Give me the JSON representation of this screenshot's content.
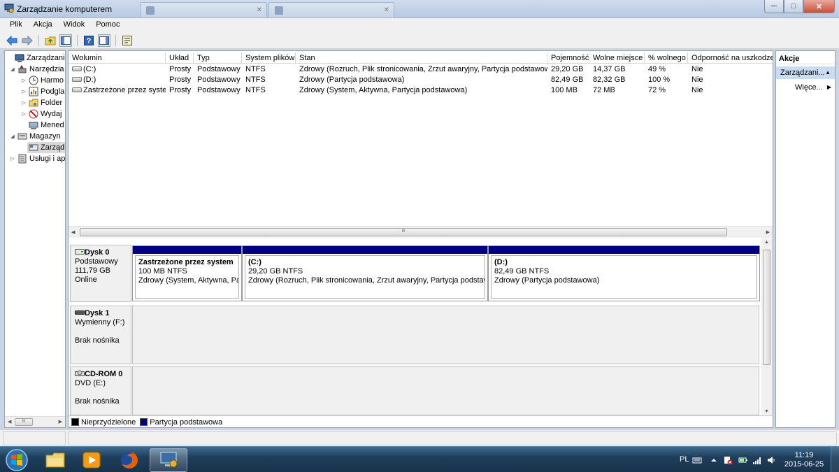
{
  "window": {
    "title": "Zarządzanie komputerem",
    "min_glyph": "─",
    "max_glyph": "□",
    "close_glyph": "✕"
  },
  "menu": [
    "Plik",
    "Akcja",
    "Widok",
    "Pomoc"
  ],
  "tree": {
    "items": [
      {
        "label": "Zarządzanie k",
        "icon": "computer-management-icon"
      },
      {
        "label": "Narzędzia",
        "icon": "tools-icon"
      },
      {
        "label": "Harmo",
        "icon": "task-scheduler-icon"
      },
      {
        "label": "Podgla",
        "icon": "event-viewer-icon"
      },
      {
        "label": "Folder",
        "icon": "shared-folder-icon"
      },
      {
        "label": "Wydaj",
        "icon": "performance-icon"
      },
      {
        "label": "Mened",
        "icon": "device-manager-icon"
      },
      {
        "label": "Magazyn",
        "icon": "storage-icon"
      },
      {
        "label": "Zarząd",
        "icon": "disk-management-icon"
      },
      {
        "label": "Usługi i ap",
        "icon": "services-icon"
      }
    ]
  },
  "volumes": {
    "columns": [
      "Wolumin",
      "Układ",
      "Typ",
      "System plików",
      "Stan",
      "Pojemność",
      "Wolne miejsce",
      "% wolnego",
      "Odporność na uszkodzenia"
    ],
    "rows": [
      [
        "(C:)",
        "Prosty",
        "Podstawowy",
        "NTFS",
        "Zdrowy (Rozruch, Plik stronicowania, Zrzut awaryjny, Partycja podstawowa)",
        "29,20 GB",
        "14,37 GB",
        "49 %",
        "Nie"
      ],
      [
        "(D:)",
        "Prosty",
        "Podstawowy",
        "NTFS",
        "Zdrowy (Partycja podstawowa)",
        "82,49 GB",
        "82,32 GB",
        "100 %",
        "Nie"
      ],
      [
        "Zastrzeżone przez system",
        "Prosty",
        "Podstawowy",
        "NTFS",
        "Zdrowy (System, Aktywna, Partycja podstawowa)",
        "100 MB",
        "72 MB",
        "72 %",
        "Nie"
      ]
    ]
  },
  "disks": {
    "disk0": {
      "name": "Dysk 0",
      "type": "Podstawowy",
      "size": "111,79 GB",
      "status": "Online",
      "partitions": [
        {
          "title": "Zastrzeżone przez system",
          "size": "100 MB NTFS",
          "status": "Zdrowy (System, Aktywna, Part"
        },
        {
          "title": "(C:)",
          "size": "29,20 GB NTFS",
          "status": "Zdrowy (Rozruch, Plik stronicowania, Zrzut awaryjny, Partycja podstawo"
        },
        {
          "title": "(D:)",
          "size": "82,49 GB NTFS",
          "status": "Zdrowy (Partycja podstawowa)"
        }
      ]
    },
    "disk1": {
      "name": "Dysk 1",
      "type": "Wymienny (F:)",
      "status": "Brak nośnika"
    },
    "cdrom0": {
      "name": "CD-ROM 0",
      "type": "DVD (E:)",
      "status": "Brak nośnika"
    }
  },
  "legend": {
    "unallocated": "Nieprzydzielone",
    "primary": "Partycja podstawowa",
    "unallocated_color": "#000000",
    "primary_color": "#000080"
  },
  "actions": {
    "header": "Akcje",
    "selected": "Zarządzani...",
    "more": "Więce..."
  },
  "taskbar": {
    "lang": "PL",
    "time": "11:19",
    "date": "2015-06-25",
    "apps": [
      "explorer-icon",
      "media-player-icon",
      "firefox-icon",
      "computer-management-icon"
    ]
  },
  "scroll_glyph": "III"
}
